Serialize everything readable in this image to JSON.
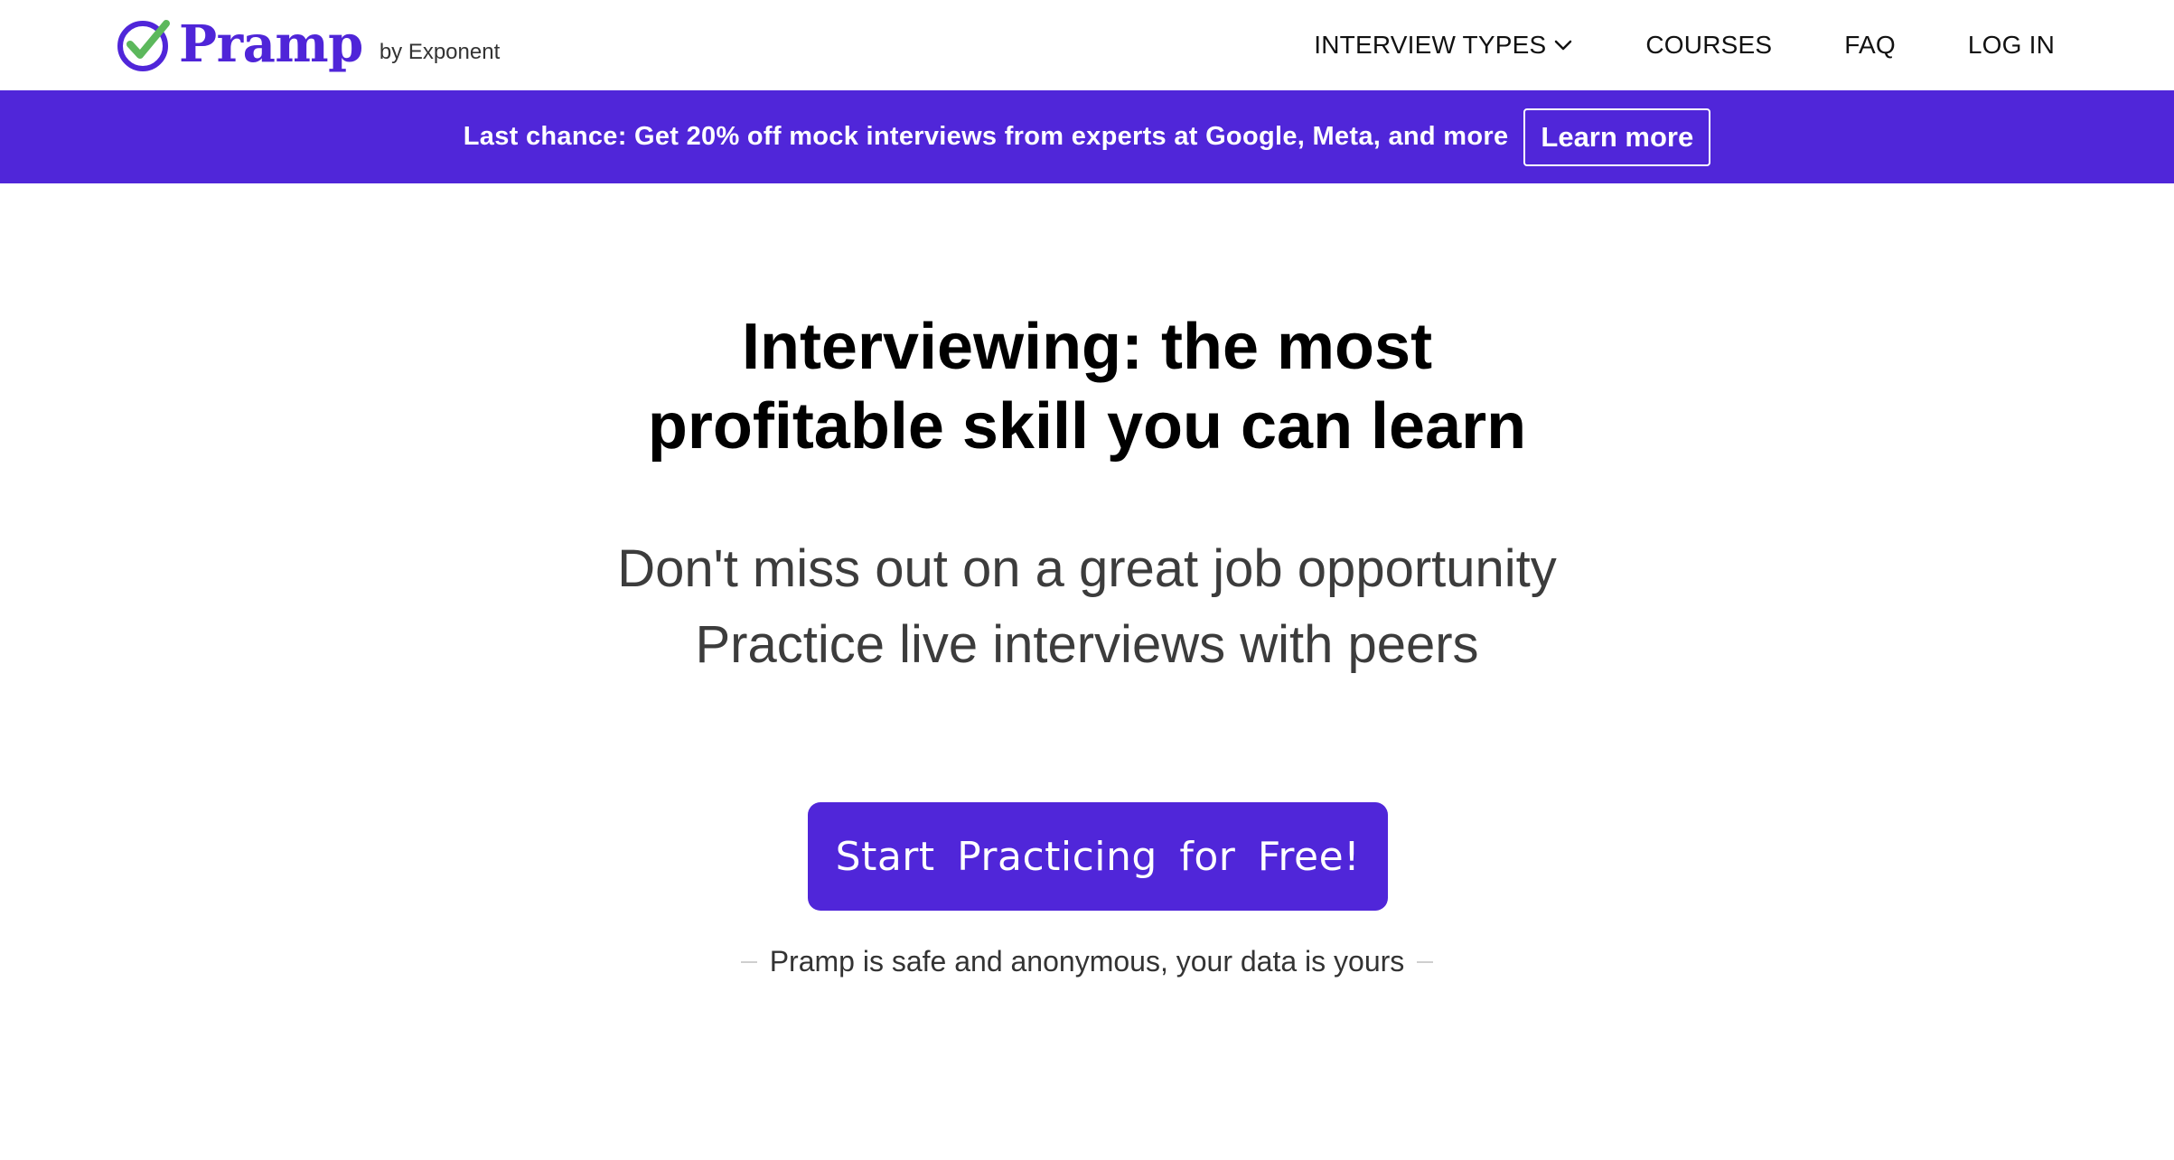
{
  "brand": {
    "name": "Pramp",
    "byline": "by Exponent",
    "primary_color": "#5026d9",
    "check_color": "#5cb85c"
  },
  "nav": {
    "items": [
      {
        "label": "INTERVIEW TYPES",
        "has_dropdown": true
      },
      {
        "label": "COURSES"
      },
      {
        "label": "FAQ"
      },
      {
        "label": "LOG IN"
      }
    ]
  },
  "banner": {
    "text": "Last chance: Get 20% off mock interviews from experts at Google, Meta, and more",
    "button_label": "Learn more"
  },
  "hero": {
    "title_line1": "Interviewing: the most",
    "title_line2": "profitable skill you can learn",
    "subtitle_line1": "Don't miss out on a great job opportunity",
    "subtitle_line2": "Practice live interviews with peers",
    "cta_label": "Start Practicing for Free!",
    "safe_note": "Pramp is safe and anonymous, your data is yours"
  }
}
